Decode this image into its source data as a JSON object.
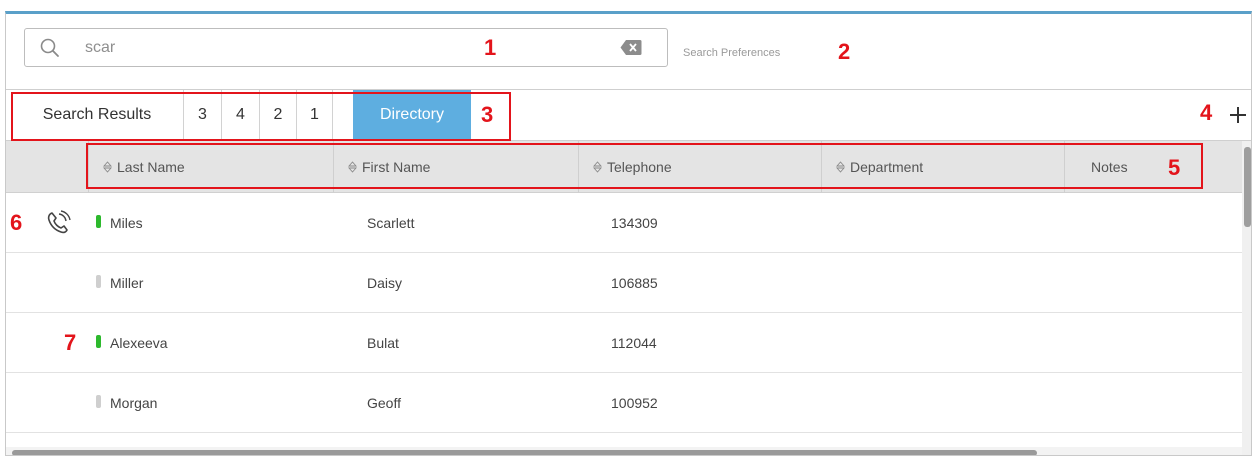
{
  "search": {
    "value": "scar",
    "preferences_label": "Search Preferences"
  },
  "tabs": [
    "Search Results",
    "3",
    "4",
    "2",
    "1",
    "Directory"
  ],
  "active_tab": "Directory",
  "columns": [
    "Last Name",
    "First Name",
    "Telephone",
    "Department",
    "Notes"
  ],
  "rows": [
    {
      "last": "Miles",
      "first": "Scarlett",
      "phone": "134309",
      "status": "available"
    },
    {
      "last": "Miller",
      "first": "Daisy",
      "phone": "106885",
      "status": "offline"
    },
    {
      "last": "Alexeeva",
      "first": "Bulat",
      "phone": "112044",
      "status": "available"
    },
    {
      "last": "Morgan",
      "first": "Geoff",
      "phone": "100952",
      "status": "offline"
    }
  ],
  "callouts": [
    "1",
    "2",
    "3",
    "4",
    "5",
    "6",
    "7"
  ],
  "icons": {
    "search": "search-icon",
    "clear": "clear-input-icon",
    "add": "plus-icon",
    "sort": "sort-icon",
    "call": "phone-ringing-icon"
  },
  "colors": {
    "accent": "#5eaee0",
    "callout": "#e3141b",
    "status_available": "#2db92d",
    "status_offline": "#cfcfcf",
    "frame_top": "#5aa0c9"
  }
}
